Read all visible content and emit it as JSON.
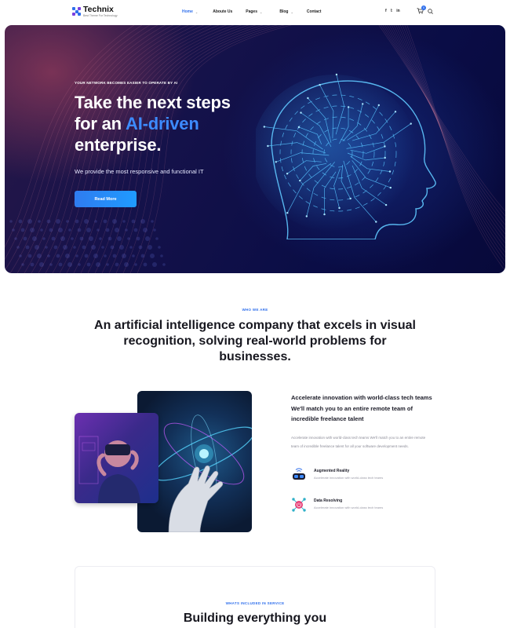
{
  "brand": {
    "name": "Technix",
    "tagline": "Best Theme For Technology"
  },
  "nav": {
    "items": [
      {
        "label": "Home",
        "dropdown": true,
        "active": true
      },
      {
        "label": "Aboute Us",
        "dropdown": false,
        "active": false
      },
      {
        "label": "Pages",
        "dropdown": true,
        "active": false
      },
      {
        "label": "Blog",
        "dropdown": true,
        "active": false
      },
      {
        "label": "Contact",
        "dropdown": false,
        "active": false
      }
    ],
    "socials": [
      "facebook-icon",
      "twitter-icon",
      "linkedin-icon"
    ],
    "social_glyphs": [
      "f",
      "𝕥",
      "in"
    ],
    "cart_count": "0"
  },
  "hero": {
    "kicker": "YOUR NETWORK BECOMES EASIER TO OPERATE BY AI",
    "title_line1": "Take the next steps",
    "title_line2_prefix": "for an ",
    "title_highlight": "AI-driven",
    "title_line3": "enterprise.",
    "subtitle": "We provide the most responsive and functional IT",
    "button_label": "Read More"
  },
  "about": {
    "kicker": "WHO WE ARE",
    "title": "An artificial intelligence company that excels in visual recognition, solving real-world problems for businesses.",
    "lead": "Accelerate innovation with world-class tech teams We'll match you to an entire remote team of incredible freelance talent",
    "body": "Accelerate innovation with world-class tech teams We'll match you to an entire remote team of incredible freelance talent for all your software development needs.",
    "features": [
      {
        "title": "Augmented Reality",
        "desc": "Accelerate innovation with world-class tech teams",
        "icon": "vr-headset-icon"
      },
      {
        "title": "Data Resolving",
        "desc": "Accelerate innovation with world-class tech teams",
        "icon": "data-network-icon"
      }
    ]
  },
  "services": {
    "kicker": "WHATS INCLUDED IN SERVICE",
    "title": "Building everything you"
  },
  "colors": {
    "accent": "#2f6fec",
    "hero_bg": "#0a0d46",
    "highlight": "#3d8bff"
  }
}
